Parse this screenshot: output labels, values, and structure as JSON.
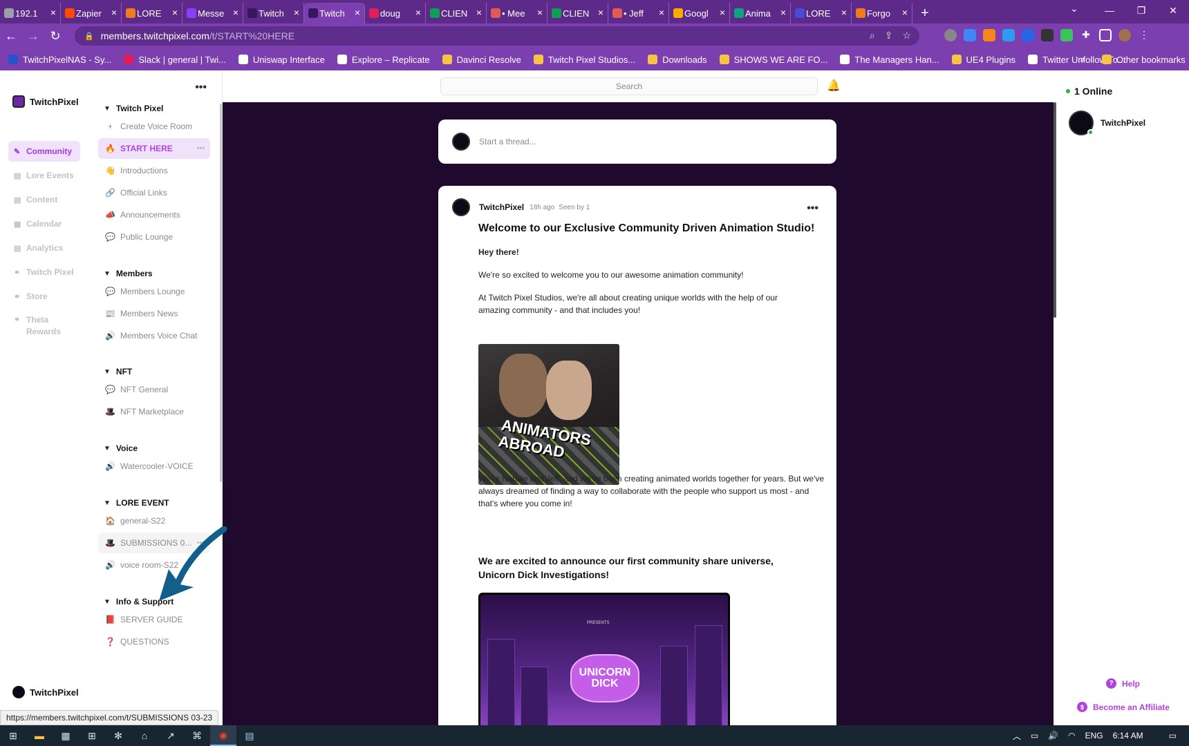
{
  "browser": {
    "tabs": [
      {
        "label": "192.1",
        "color": "#9aa0a6",
        "active": false
      },
      {
        "label": "Zapier",
        "color": "#ff4a00",
        "active": false
      },
      {
        "label": "LORE",
        "color": "#f07b1c",
        "active": false
      },
      {
        "label": "Messe",
        "color": "#8a3ffc",
        "active": false
      },
      {
        "label": "Twitch",
        "color": "#3a1660",
        "active": false
      },
      {
        "label": "Twitch",
        "color": "#3a1660",
        "active": true
      },
      {
        "label": "doug",
        "color": "#e01e5a",
        "active": false
      },
      {
        "label": "CLIEN",
        "color": "#0f9d58",
        "active": false
      },
      {
        "label": "• Mee",
        "color": "#e05a5a",
        "active": false
      },
      {
        "label": "CLIEN",
        "color": "#0f9d58",
        "active": false
      },
      {
        "label": "• Jeff",
        "color": "#e05a5a",
        "active": false
      },
      {
        "label": "Googl",
        "color": "#f9ab00",
        "active": false
      },
      {
        "label": "Anima",
        "color": "#10a37f",
        "active": false
      },
      {
        "label": "LORE",
        "color": "#4a4ad9",
        "active": false
      },
      {
        "label": "Forgo",
        "color": "#f07b1c",
        "active": false
      }
    ],
    "url_host": "members.twitchpixel.com",
    "url_path": "/t/START%20HERE",
    "bookmarks": [
      {
        "label": "TwitchPixelNAS - Sy...",
        "color": "#2255cc"
      },
      {
        "label": "Slack | general | Twi...",
        "color": "#e01e5a"
      },
      {
        "label": "Uniswap Interface",
        "color": "#ffffff"
      },
      {
        "label": "Explore – Replicate",
        "color": "#ffffff"
      },
      {
        "label": "Davinci Resolve",
        "color": "#f6c344"
      },
      {
        "label": "Twitch Pixel Studios...",
        "color": "#f6c344"
      },
      {
        "label": "Downloads",
        "color": "#f6c344"
      },
      {
        "label": "SHOWS WE ARE FO...",
        "color": "#f6c344"
      },
      {
        "label": "The Managers Han...",
        "color": "#ffffff"
      },
      {
        "label": "UE4 Plugins",
        "color": "#f6c344"
      },
      {
        "label": "Twitter Unfollow To...",
        "color": "#ffffff"
      }
    ],
    "bookmarks_more": "»",
    "other_bookmarks": "Other bookmarks",
    "status_url": "https://members.twitchpixel.com/t/SUBMISSIONS 03-23"
  },
  "rail": {
    "brand": "TwitchPixel",
    "items": [
      {
        "label": "Community",
        "icon": "✎",
        "active": true
      },
      {
        "label": "Lore Events",
        "icon": "▤",
        "active": false
      },
      {
        "label": "Content",
        "icon": "▤",
        "active": false
      },
      {
        "label": "Calendar",
        "icon": "▦",
        "active": false
      },
      {
        "label": "Analytics",
        "icon": "▤",
        "active": false
      },
      {
        "label": "Twitch Pixel",
        "icon": "⚭",
        "active": false
      },
      {
        "label": "Store",
        "icon": "⚭",
        "active": false
      },
      {
        "label": "Theta Rewards",
        "icon": "⚭",
        "active": false
      }
    ],
    "user": "TwitchPixel"
  },
  "channels": {
    "groups": [
      {
        "title": "Twitch Pixel",
        "items": [
          {
            "label": "Create Voice Room",
            "icon": "+",
            "state": "normal"
          },
          {
            "label": "START HERE",
            "icon": "🔥",
            "state": "active"
          },
          {
            "label": "Introductions",
            "icon": "👋",
            "state": "normal"
          },
          {
            "label": "Official Links",
            "icon": "🔗",
            "state": "normal"
          },
          {
            "label": "Announcements",
            "icon": "📣",
            "state": "normal"
          },
          {
            "label": "Public Lounge",
            "icon": "💬",
            "state": "normal"
          }
        ]
      },
      {
        "title": "Members",
        "items": [
          {
            "label": "Members Lounge",
            "icon": "💬",
            "state": "normal"
          },
          {
            "label": "Members News",
            "icon": "📰",
            "state": "normal"
          },
          {
            "label": "Members Voice Chat",
            "icon": "🔊",
            "state": "normal"
          }
        ]
      },
      {
        "title": "NFT",
        "items": [
          {
            "label": "NFT General",
            "icon": "💬",
            "state": "normal"
          },
          {
            "label": "NFT Marketplace",
            "icon": "🎩",
            "state": "normal"
          }
        ]
      },
      {
        "title": "Voice",
        "items": [
          {
            "label": "Watercooler-VOICE",
            "icon": "🔊",
            "state": "normal"
          }
        ]
      },
      {
        "title": "LORE EVENT",
        "items": [
          {
            "label": "general-S22",
            "icon": "🏠",
            "state": "normal"
          },
          {
            "label": "SUBMISSIONS 0...",
            "icon": "🎩",
            "state": "hover"
          },
          {
            "label": "voice room-S22",
            "icon": "🔊",
            "state": "normal"
          }
        ]
      },
      {
        "title": "Info & Support",
        "items": [
          {
            "label": "SERVER GUIDE",
            "icon": "📕",
            "state": "normal"
          },
          {
            "label": "QUESTIONS",
            "icon": "❓",
            "state": "normal"
          }
        ]
      }
    ],
    "item_more": "•••"
  },
  "topbar": {
    "search_placeholder": "Search"
  },
  "composer": {
    "placeholder": "Start a thread..."
  },
  "post": {
    "author": "TwitchPixel",
    "time": "18h ago",
    "seen": "Seen by 1",
    "title": "Welcome to our Exclusive Community Driven Animation Studio!",
    "greeting": "Hey there!",
    "p1": "We're so excited to welcome you to our awesome animation community!",
    "p2": "At Twitch Pixel Studios, we're all about creating unique worlds with the help of our amazing community - and that includes you!",
    "image1_caption": "ANIMATORS ABROAD",
    "p3": "We're Natalie and Jeff, and we've been creating animated worlds together for years. But we've always dreamed of finding a way to collaborate with the people who support us most - and that's where you come in!",
    "heading": "We are excited to announce our first community share universe, Unicorn Dick Investigations!",
    "image2_logo": "UNICORN DICK",
    "image2_presents": "PRESENTS"
  },
  "right": {
    "online": "1 Online",
    "user": "TwitchPixel",
    "help": "Help",
    "affiliate": "Become an Affiliate"
  },
  "taskbar": {
    "lang": "ENG",
    "time": "6:14 AM"
  },
  "colors": {
    "accent": "#b043e0",
    "browser_frame": "#7c3fb0",
    "feed_bg": "#1f0a2e",
    "annotation_arrow": "#135e8a"
  }
}
